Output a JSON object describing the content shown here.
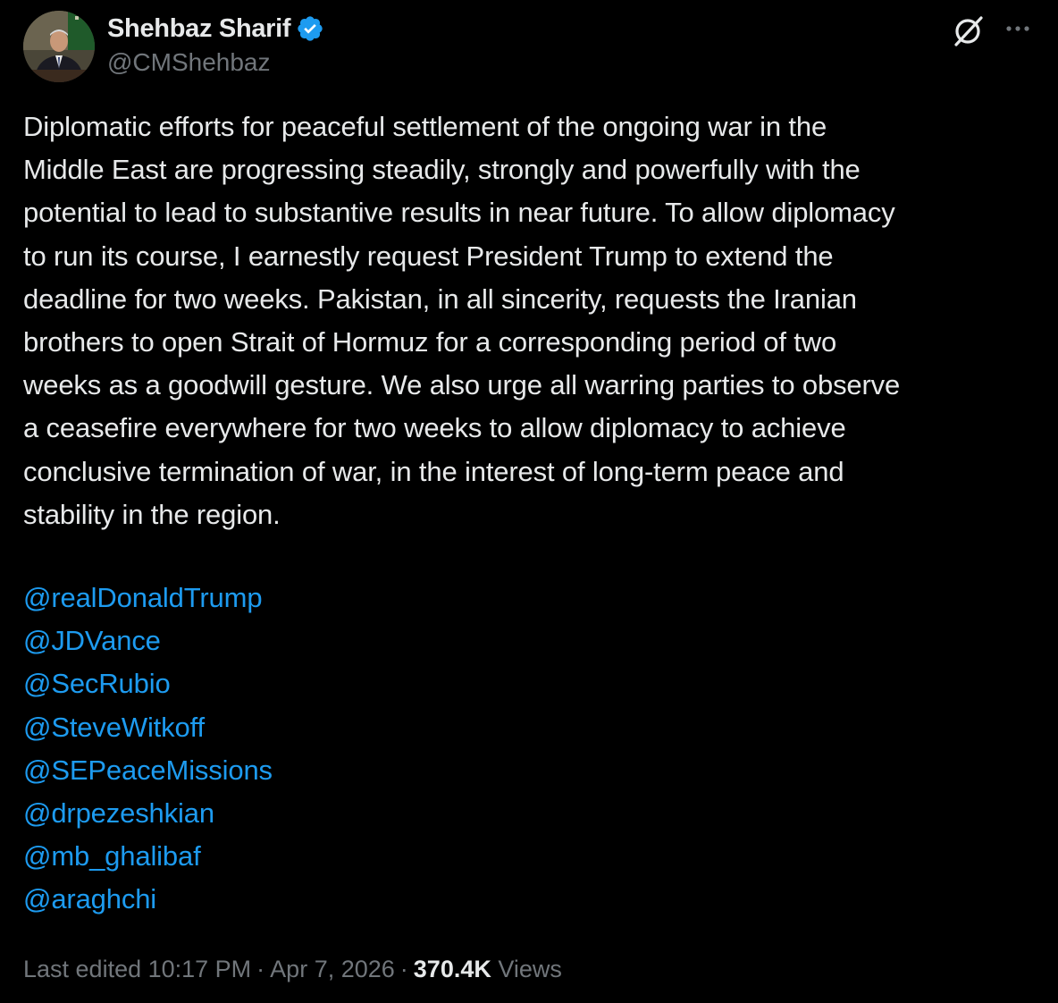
{
  "author": {
    "display_name": "Shehbaz Sharif",
    "handle": "@CMShehbaz",
    "verified": true,
    "verified_badge_color": "#1d9bf0",
    "avatar_icon": "profile-photo"
  },
  "actions": {
    "grok_icon": "grok-icon",
    "more_icon": "more-dots-icon"
  },
  "tweet": {
    "text": "Diplomatic efforts for peaceful settlement of the ongoing war in the\nMiddle East are progressing steadily, strongly and powerfully with the\npotential to lead to substantive results in near future. To allow diplomacy\nto run its course, I earnestly request President Trump to extend the\ndeadline for two weeks. Pakistan, in all sincerity, requests the Iranian\nbrothers to open Strait of Hormuz for a corresponding period of two\nweeks as a goodwill gesture. We also urge all warring parties to observe\na ceasefire everywhere for two weeks to allow diplomacy to achieve\nconclusive termination of war, in the interest of long-term peace and\nstability in the region.",
    "mentions": [
      "@realDonaldTrump",
      "@JDVance",
      "@SecRubio",
      "@SteveWitkoff",
      "@SEPeaceMissions",
      "@drpezeshkian",
      "@mb_ghalibaf",
      "@araghchi"
    ],
    "mention_color": "#1d9bf0"
  },
  "meta": {
    "edited_label": "Last edited 10:17 PM",
    "separator": "·",
    "date": "Apr 7, 2026",
    "views_count": "370.4K",
    "views_label": "Views"
  },
  "colors": {
    "background": "#000000",
    "primary_text": "#e7e9ea",
    "secondary_text": "#71767b",
    "link": "#1d9bf0"
  }
}
